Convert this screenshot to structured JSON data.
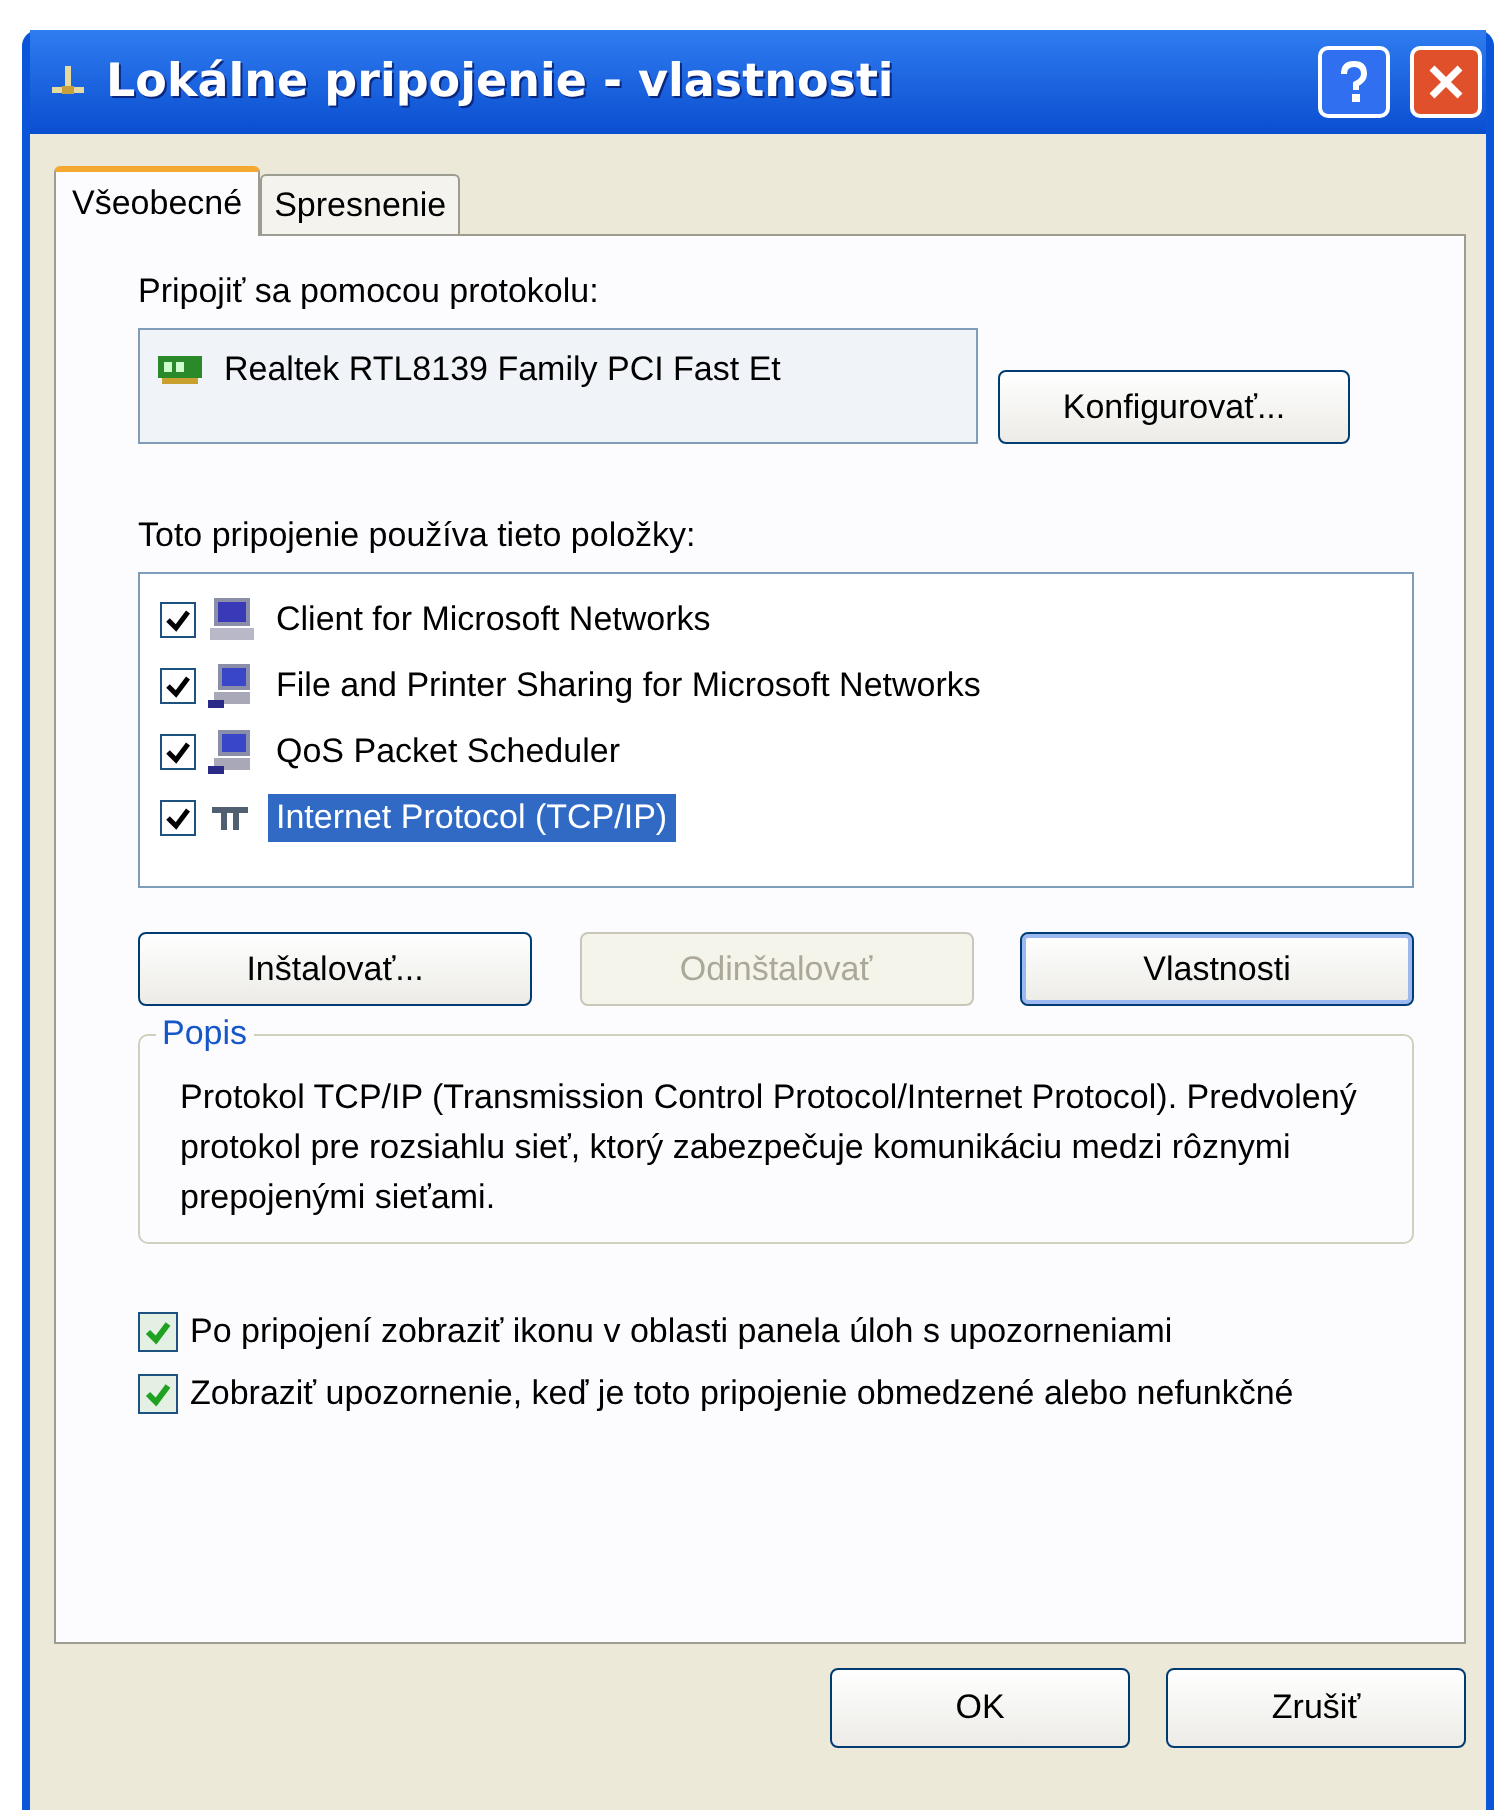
{
  "window": {
    "title": "Lokálne pripojenie - vlastnosti"
  },
  "tabs": [
    {
      "label": "Všeobecné",
      "selected": true
    },
    {
      "label": "Spresnenie",
      "selected": false
    }
  ],
  "connect_using": {
    "label": "Pripojiť sa pomocou protokolu:",
    "adapter": "Realtek RTL8139 Family PCI Fast Et",
    "button": "Konfigurovať..."
  },
  "components": {
    "label": "Toto pripojenie používa tieto položky:",
    "items": [
      {
        "kind": "client",
        "label": "Client for Microsoft Networks",
        "checked": true,
        "selected": false
      },
      {
        "kind": "service",
        "label": "File and Printer Sharing for Microsoft Networks",
        "checked": true,
        "selected": false
      },
      {
        "kind": "service",
        "label": "QoS Packet Scheduler",
        "checked": true,
        "selected": false
      },
      {
        "kind": "protocol",
        "label": "Internet Protocol (TCP/IP)",
        "checked": true,
        "selected": true
      }
    ]
  },
  "component_buttons": [
    {
      "label": "Inštalovať...",
      "disabled": false,
      "default": false
    },
    {
      "label": "Odinštalovať",
      "disabled": true,
      "default": false
    },
    {
      "label": "Vlastnosti",
      "disabled": false,
      "default": true
    }
  ],
  "description": {
    "title": "Popis",
    "text": "Protokol TCP/IP (Transmission Control Protocol/Internet Protocol). Predvolený protokol pre rozsiahlu sieť, ktorý zabezpečuje komunikáciu medzi rôznymi prepojenými sieťami."
  },
  "options": [
    {
      "label": "Po pripojení zobraziť ikonu v oblasti panela úloh s upozorneniami",
      "checked": true
    },
    {
      "label": "Zobraziť upozornenie, keď je toto pripojenie obmedzené alebo nefunkčné",
      "checked": true
    }
  ],
  "dialog_buttons": [
    "OK",
    "Zrušiť"
  ]
}
